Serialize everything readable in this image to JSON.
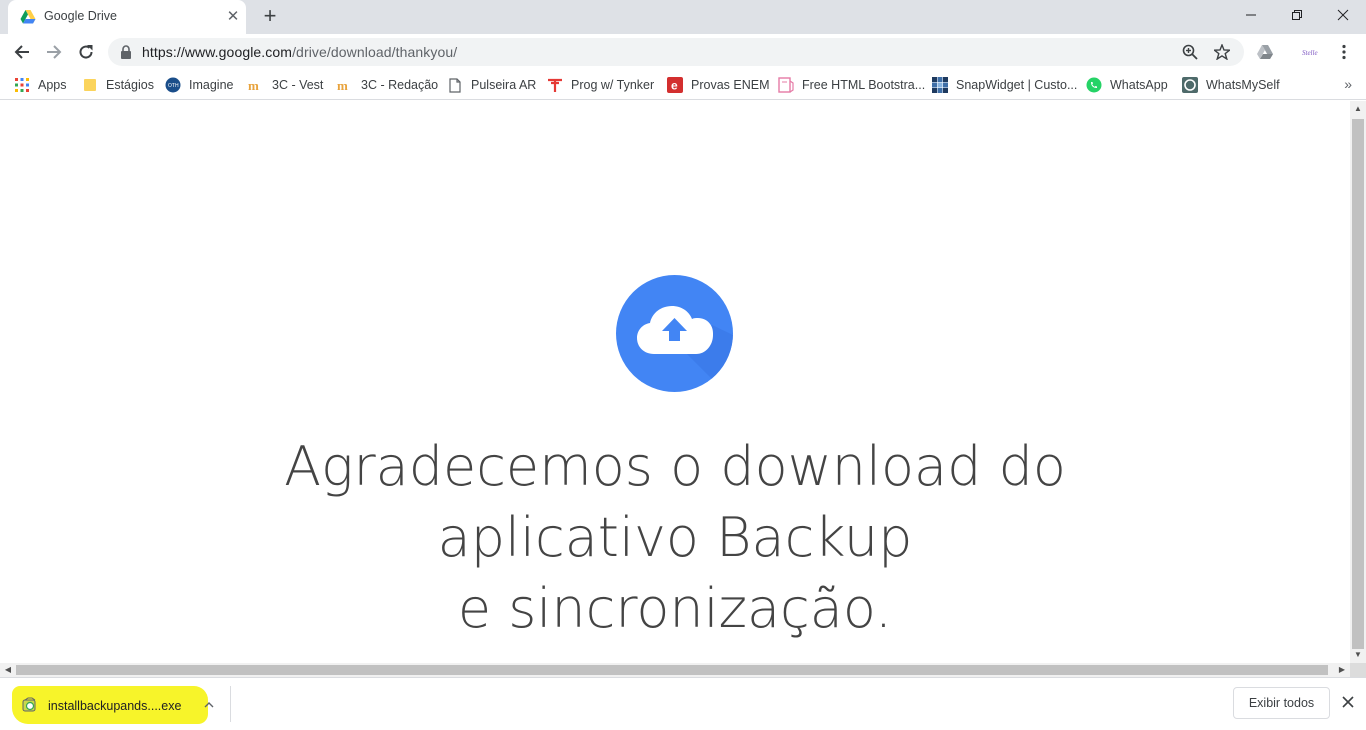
{
  "tab": {
    "title": "Google Drive",
    "close": "✕"
  },
  "newtab": "+",
  "window": {
    "minimize": "—",
    "restore": "❐",
    "close": "✕"
  },
  "omnibox": {
    "url_host": "https://www.google.com",
    "url_path": "/drive/download/thankyou/"
  },
  "bookmarks": [
    {
      "label": "Apps",
      "icon": "apps-grid-icon"
    },
    {
      "label": "Estágios",
      "icon": "folder-icon"
    },
    {
      "label": "Imagine",
      "icon": "imagine-icon"
    },
    {
      "label": "3C - Vest",
      "icon": "m-icon"
    },
    {
      "label": "3C - Redação",
      "icon": "m-icon"
    },
    {
      "label": "Pulseira AR",
      "icon": "page-icon"
    },
    {
      "label": "Prog w/ Tynker",
      "icon": "tynker-icon"
    },
    {
      "label": "Provas ENEM",
      "icon": "e-icon"
    },
    {
      "label": "Free HTML Bootstra...",
      "icon": "bootstrap-icon"
    },
    {
      "label": "SnapWidget | Custo...",
      "icon": "snapwidget-icon"
    },
    {
      "label": "WhatsApp",
      "icon": "whatsapp-icon"
    },
    {
      "label": "WhatsMySelf",
      "icon": "whatsmyself-icon"
    }
  ],
  "bookmarks_more": "»",
  "headline": {
    "line1": "Agradecemos o download do",
    "line2": "aplicativo Backup",
    "line3": "e sincronização."
  },
  "download": {
    "filename": "installbackupands....exe",
    "show_all": "Exibir todos",
    "close": "✕",
    "caret": "^"
  },
  "colors": {
    "accent_blue": "#4285f4",
    "highlight": "#f7f42a"
  }
}
